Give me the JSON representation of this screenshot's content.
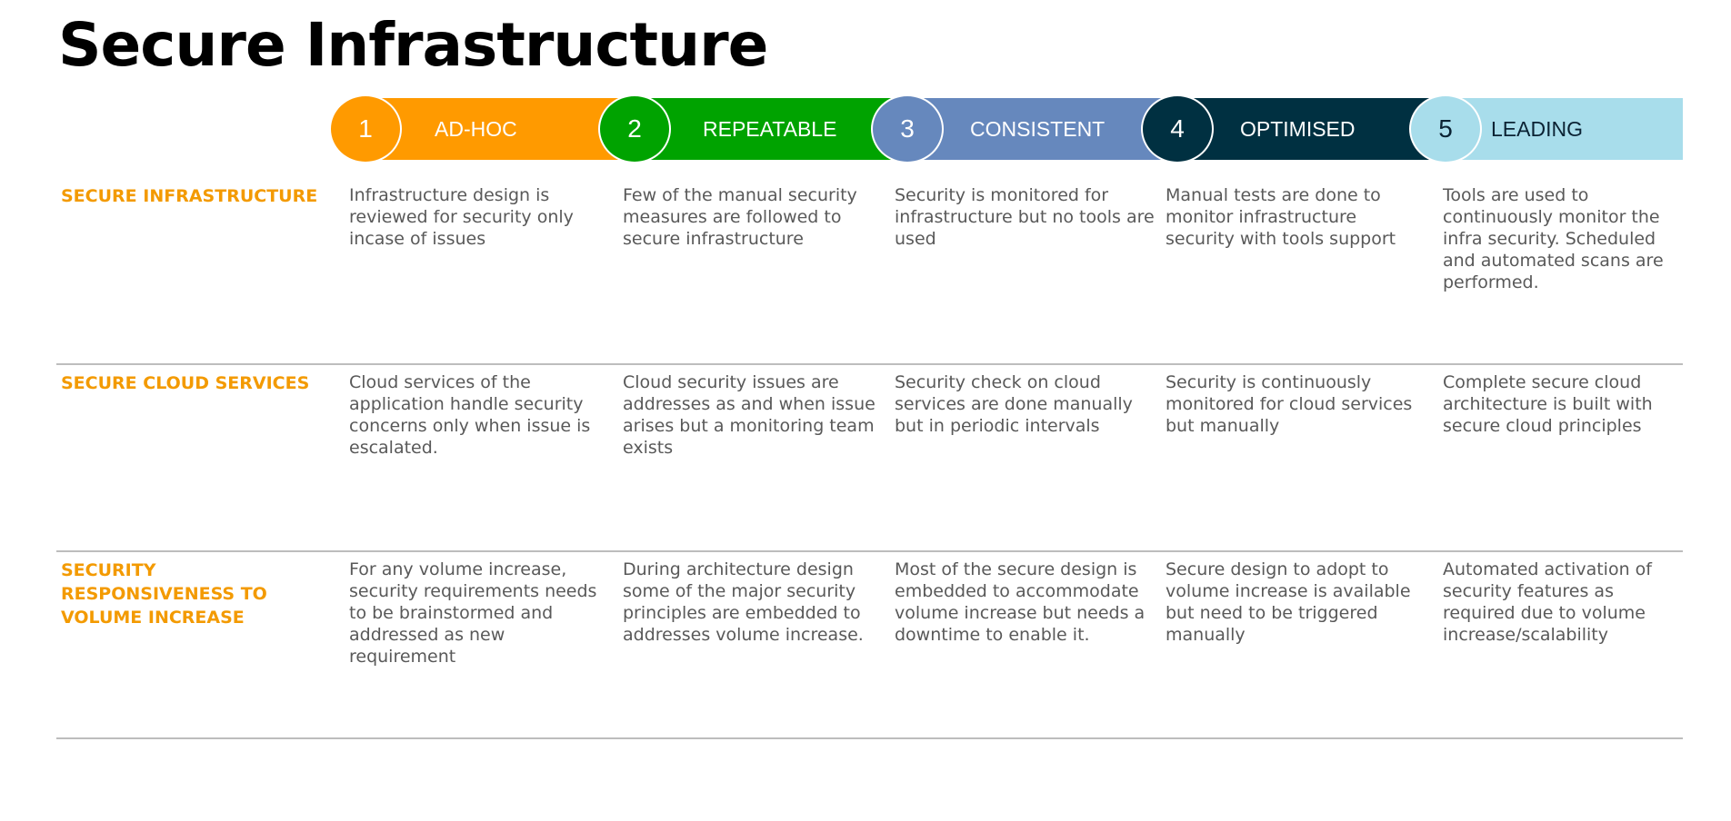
{
  "title": "Secure Infrastructure",
  "levels": [
    {
      "number": "1",
      "label": "AD-HOC",
      "color": "#ff9a00",
      "text_color": "#ffffff"
    },
    {
      "number": "2",
      "label": "REPEATABLE",
      "color": "#00a300",
      "text_color": "#ffffff"
    },
    {
      "number": "3",
      "label": "CONSISTENT",
      "color": "#6688bd",
      "text_color": "#ffffff"
    },
    {
      "number": "4",
      "label": "OPTIMISED",
      "color": "#003041",
      "text_color": "#ffffff"
    },
    {
      "number": "5",
      "label": "LEADING",
      "color": "#a8ddeb",
      "text_color": "#0b2233"
    }
  ],
  "rows": [
    {
      "label": "SECURE INFRASTRUCTURE",
      "cells": [
        "Infrastructure design is reviewed for security only incase of issues",
        "Few of the manual security measures are followed to secure infrastructure",
        "Security is monitored for infrastructure but no tools are used",
        "Manual tests are done to monitor infrastructure security with tools support",
        "Tools are used to continuously monitor the infra security. Scheduled and automated scans are performed."
      ]
    },
    {
      "label": "SECURE CLOUD SERVICES",
      "cells": [
        "Cloud services of the application handle security concerns only when issue is escalated.",
        "Cloud security issues are addresses as and when issue arises but a monitoring team exists",
        "Security check on cloud services are done manually but in periodic intervals",
        "Security is continuously monitored for cloud services but manually",
        "Complete secure cloud architecture is built with secure cloud principles"
      ]
    },
    {
      "label": "SECURITY RESPONSIVENESS TO VOLUME INCREASE",
      "cells": [
        "For any volume increase, security requirements needs to be brainstormed and addressed as new requirement",
        "During architecture design some of the major security principles are embedded to addresses volume increase.",
        "Most of the secure design is embedded to accommodate volume increase but needs a downtime to enable it.",
        "Secure design to adopt to volume increase is available but need to be triggered manually",
        "Automated activation of security features as required due to volume increase/scalability"
      ]
    }
  ]
}
